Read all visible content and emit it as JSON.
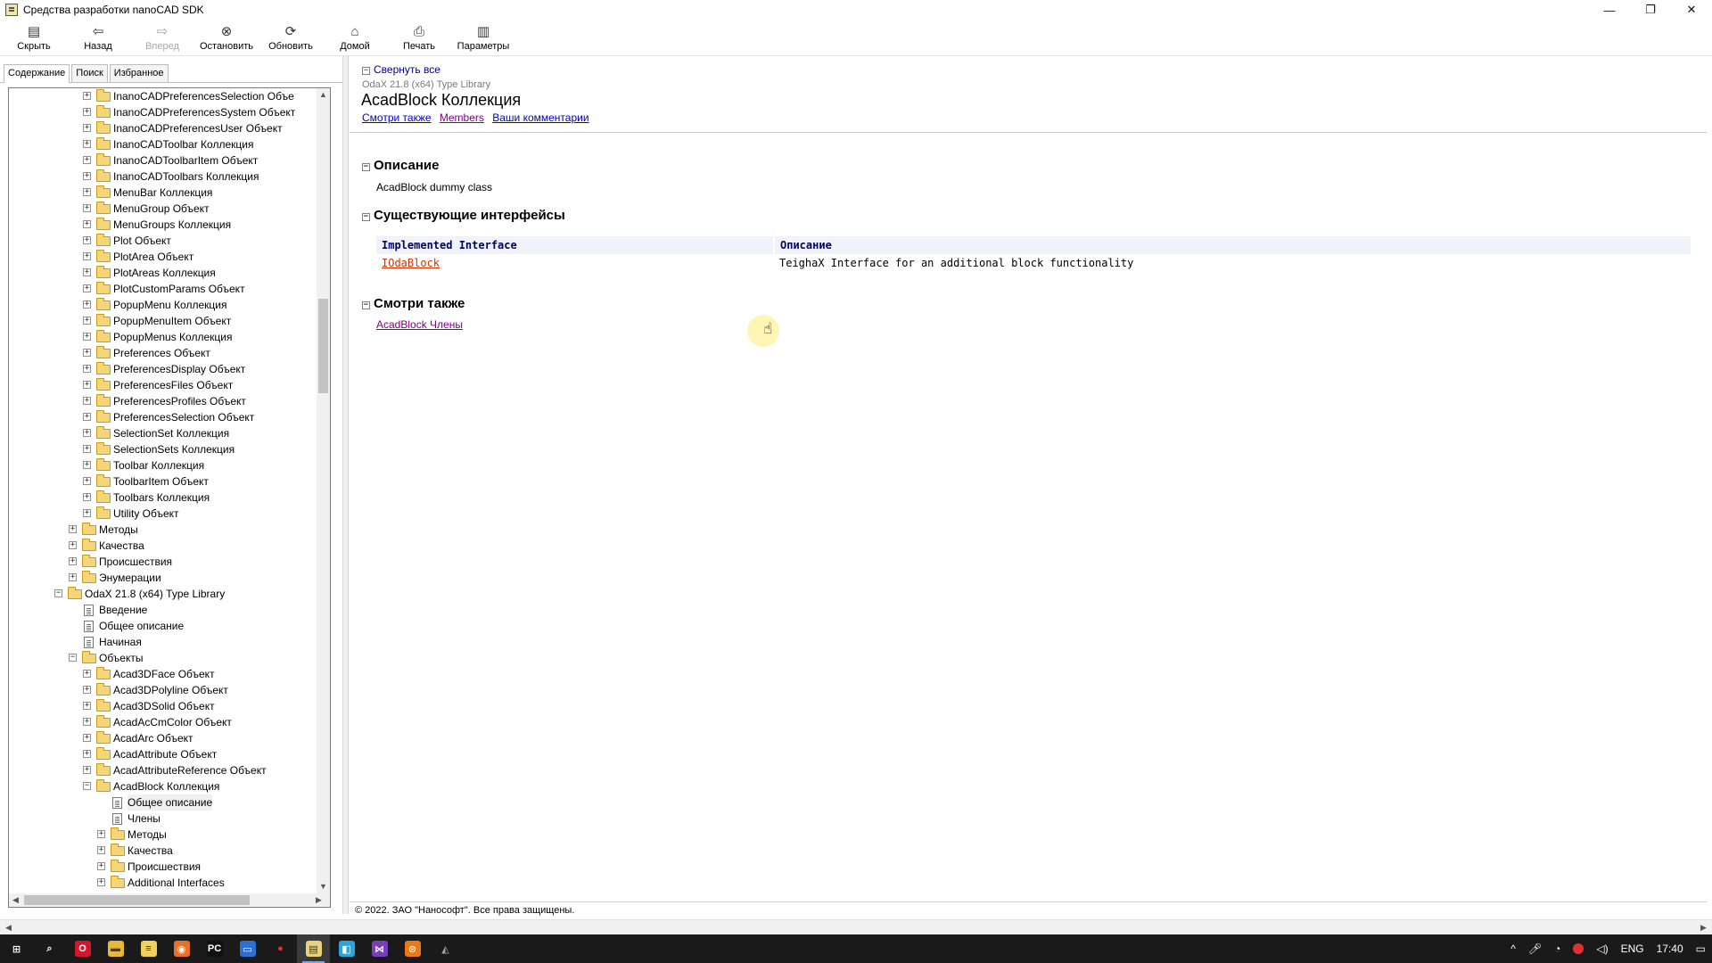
{
  "window": {
    "title": "Средства разработки nanoCAD SDK",
    "minimize": "—",
    "restore": "❐",
    "close": "✕"
  },
  "toolbar": [
    {
      "label": "Скрыть",
      "icon": "hide-panel-icon",
      "glyph": "▤",
      "enabled": true
    },
    {
      "label": "Назад",
      "icon": "back-arrow-icon",
      "glyph": "⇦",
      "enabled": true
    },
    {
      "label": "Вперед",
      "icon": "forward-arrow-icon",
      "glyph": "⇨",
      "enabled": false
    },
    {
      "label": "Остановить",
      "icon": "stop-icon",
      "glyph": "⊗",
      "enabled": true
    },
    {
      "label": "Обновить",
      "icon": "refresh-icon",
      "glyph": "⟳",
      "enabled": true
    },
    {
      "label": "Домой",
      "icon": "home-icon",
      "glyph": "⌂",
      "enabled": true
    },
    {
      "label": "Печать",
      "icon": "print-icon",
      "glyph": "⎙",
      "enabled": true
    },
    {
      "label": "Параметры",
      "icon": "options-icon",
      "glyph": "▥",
      "enabled": true
    }
  ],
  "tabs": [
    "Содержание",
    "Поиск",
    "Избранное"
  ],
  "tree": [
    {
      "label": "InanoCADPreferencesSelection Объе",
      "level": 2,
      "type": "folder",
      "state": "collapsed"
    },
    {
      "label": "InanoCADPreferencesSystem Объект",
      "level": 2,
      "type": "folder",
      "state": "collapsed"
    },
    {
      "label": "InanoCADPreferencesUser Объект",
      "level": 2,
      "type": "folder",
      "state": "collapsed"
    },
    {
      "label": "InanoCADToolbar Коллекция",
      "level": 2,
      "type": "folder",
      "state": "collapsed"
    },
    {
      "label": "InanoCADToolbarItem Объект",
      "level": 2,
      "type": "folder",
      "state": "collapsed"
    },
    {
      "label": "InanoCADToolbars Коллекция",
      "level": 2,
      "type": "folder",
      "state": "collapsed"
    },
    {
      "label": "MenuBar Коллекция",
      "level": 2,
      "type": "folder",
      "state": "collapsed"
    },
    {
      "label": "MenuGroup Объект",
      "level": 2,
      "type": "folder",
      "state": "collapsed"
    },
    {
      "label": "MenuGroups Коллекция",
      "level": 2,
      "type": "folder",
      "state": "collapsed"
    },
    {
      "label": "Plot Объект",
      "level": 2,
      "type": "folder",
      "state": "collapsed"
    },
    {
      "label": "PlotArea Объект",
      "level": 2,
      "type": "folder",
      "state": "collapsed"
    },
    {
      "label": "PlotAreas Коллекция",
      "level": 2,
      "type": "folder",
      "state": "collapsed"
    },
    {
      "label": "PlotCustomParams Объект",
      "level": 2,
      "type": "folder",
      "state": "collapsed"
    },
    {
      "label": "PopupMenu Коллекция",
      "level": 2,
      "type": "folder",
      "state": "collapsed"
    },
    {
      "label": "PopupMenuItem Объект",
      "level": 2,
      "type": "folder",
      "state": "collapsed"
    },
    {
      "label": "PopupMenus Коллекция",
      "level": 2,
      "type": "folder",
      "state": "collapsed"
    },
    {
      "label": "Preferences Объект",
      "level": 2,
      "type": "folder",
      "state": "collapsed"
    },
    {
      "label": "PreferencesDisplay Объект",
      "level": 2,
      "type": "folder",
      "state": "collapsed"
    },
    {
      "label": "PreferencesFiles Объект",
      "level": 2,
      "type": "folder",
      "state": "collapsed"
    },
    {
      "label": "PreferencesProfiles Объект",
      "level": 2,
      "type": "folder",
      "state": "collapsed"
    },
    {
      "label": "PreferencesSelection Объект",
      "level": 2,
      "type": "folder",
      "state": "collapsed"
    },
    {
      "label": "SelectionSet Коллекция",
      "level": 2,
      "type": "folder",
      "state": "collapsed"
    },
    {
      "label": "SelectionSets Коллекция",
      "level": 2,
      "type": "folder",
      "state": "collapsed"
    },
    {
      "label": "Toolbar Коллекция",
      "level": 2,
      "type": "folder",
      "state": "collapsed"
    },
    {
      "label": "ToolbarItem Объект",
      "level": 2,
      "type": "folder",
      "state": "collapsed"
    },
    {
      "label": "Toolbars Коллекция",
      "level": 2,
      "type": "folder",
      "state": "collapsed"
    },
    {
      "label": "Utility Объект",
      "level": 2,
      "type": "folder",
      "state": "collapsed"
    },
    {
      "label": "Методы",
      "level": 1,
      "type": "folder",
      "state": "collapsed"
    },
    {
      "label": "Качества",
      "level": 1,
      "type": "folder",
      "state": "collapsed"
    },
    {
      "label": "Происшествия",
      "level": 1,
      "type": "folder",
      "state": "collapsed"
    },
    {
      "label": "Энумерации",
      "level": 1,
      "type": "folder",
      "state": "collapsed"
    },
    {
      "label": "OdaX 21.8 (x64) Type Library",
      "level": 0,
      "type": "folder",
      "state": "expanded"
    },
    {
      "label": "Введение",
      "level": 1,
      "type": "page",
      "state": "none"
    },
    {
      "label": "Общее описание",
      "level": 1,
      "type": "page",
      "state": "none"
    },
    {
      "label": "Начиная",
      "level": 1,
      "type": "page",
      "state": "none"
    },
    {
      "label": "Объекты",
      "level": 1,
      "type": "folder",
      "state": "expanded"
    },
    {
      "label": "Acad3DFace Объект",
      "level": 2,
      "type": "folder",
      "state": "collapsed"
    },
    {
      "label": "Acad3DPolyline Объект",
      "level": 2,
      "type": "folder",
      "state": "collapsed"
    },
    {
      "label": "Acad3DSolid Объект",
      "level": 2,
      "type": "folder",
      "state": "collapsed"
    },
    {
      "label": "AcadAcCmColor Объект",
      "level": 2,
      "type": "folder",
      "state": "collapsed"
    },
    {
      "label": "AcadArc Объект",
      "level": 2,
      "type": "folder",
      "state": "collapsed"
    },
    {
      "label": "AcadAttribute Объект",
      "level": 2,
      "type": "folder",
      "state": "collapsed"
    },
    {
      "label": "AcadAttributeReference Объект",
      "level": 2,
      "type": "folder",
      "state": "collapsed"
    },
    {
      "label": "AcadBlock Коллекция",
      "level": 2,
      "type": "folder",
      "state": "expanded"
    },
    {
      "label": "Общее описание",
      "level": 3,
      "type": "page",
      "state": "none",
      "selected": true
    },
    {
      "label": "Члены",
      "level": 3,
      "type": "page",
      "state": "none"
    },
    {
      "label": "Методы",
      "level": 3,
      "type": "folder",
      "state": "collapsed"
    },
    {
      "label": "Качества",
      "level": 3,
      "type": "folder",
      "state": "collapsed"
    },
    {
      "label": "Происшествия",
      "level": 3,
      "type": "folder",
      "state": "collapsed"
    },
    {
      "label": "Additional Interfaces",
      "level": 3,
      "type": "folder",
      "state": "collapsed"
    }
  ],
  "content": {
    "collapse_all": "Свернуть все",
    "library": "OdaX 21.8 (x64) Type Library",
    "title": "AcadBlock Коллекция",
    "links": [
      "Смотри также",
      "Members",
      "Ваши комментарии"
    ],
    "description_heading": "Описание",
    "description": "AcadBlock dummy class",
    "interfaces_heading": "Существующие интерфейсы",
    "table_headers": [
      "Implemented Interface",
      "Описание"
    ],
    "table_rows": [
      {
        "name": "IOdaBlock",
        "description": "TeighaX Interface for an additional block functionality"
      }
    ],
    "see_also_heading": "Смотри также",
    "see_also_link": "AcadBlock Члены",
    "footer": "© 2022. ЗАО \"Нанософт\". Все права защищены."
  },
  "taskbar": {
    "apps": [
      {
        "name": "windows-start-icon",
        "glyph": "⊞",
        "color": "#1a1a1a",
        "fg": "#ffffff"
      },
      {
        "name": "search-icon",
        "glyph": "⌕",
        "color": "#1a1a1a",
        "fg": "#ffffff"
      },
      {
        "name": "opera-browser-icon",
        "glyph": "O",
        "color": "#d1172b",
        "fg": "#ffffff"
      },
      {
        "name": "file-explorer-icon",
        "glyph": "▬",
        "color": "#e8b83a",
        "fg": "#5a3d00"
      },
      {
        "name": "notepad-icon",
        "glyph": "≡",
        "color": "#f0d060",
        "fg": "#333333"
      },
      {
        "name": "firefox-icon",
        "glyph": "◉",
        "color": "#e8702a",
        "fg": "#ffffff"
      },
      {
        "name": "pycharm-icon",
        "glyph": "PC",
        "color": "#111111",
        "fg": "#ffffff"
      },
      {
        "name": "app-blue-icon",
        "glyph": "▭",
        "color": "#2f6fd0",
        "fg": "#ffffff"
      },
      {
        "name": "record-icon",
        "glyph": "●",
        "color": "#1a1a1a",
        "fg": "#e03030"
      },
      {
        "name": "nanocad-sdk-icon",
        "glyph": "▤",
        "color": "#e8d27a",
        "fg": "#333333",
        "active": true
      },
      {
        "name": "app-cyan-icon",
        "glyph": "◧",
        "color": "#2aa7d8",
        "fg": "#ffffff"
      },
      {
        "name": "visual-studio-icon",
        "glyph": "⋈",
        "color": "#7a3fb8",
        "fg": "#ffffff"
      },
      {
        "name": "app-orange-icon",
        "glyph": "⊙",
        "color": "#e87a1a",
        "fg": "#ffffff"
      },
      {
        "name": "app-misc-icon",
        "glyph": "◭",
        "color": "#1a1a1a",
        "fg": "#9aa8b8"
      }
    ],
    "tray": {
      "chevron": "^",
      "lang": "ENG",
      "time": "17:40"
    }
  }
}
